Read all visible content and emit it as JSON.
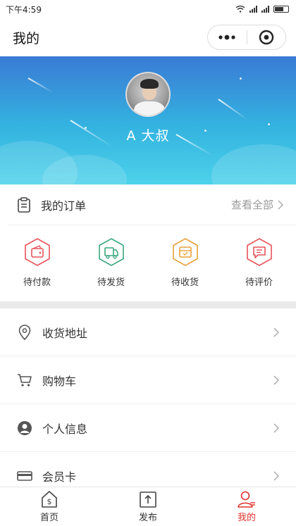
{
  "status": {
    "time": "下午4:59"
  },
  "nav": {
    "title": "我的"
  },
  "profile": {
    "name": "A 大叔"
  },
  "orders": {
    "title": "我的订单",
    "view_all": "查看全部",
    "items": [
      {
        "label": "待付款",
        "color": "#e8525a",
        "icon": "wallet-icon"
      },
      {
        "label": "待发货",
        "color": "#3aa77d",
        "icon": "truck-icon"
      },
      {
        "label": "待收货",
        "color": "#e8a13a",
        "icon": "package-icon"
      },
      {
        "label": "待评价",
        "color": "#e8525a",
        "icon": "comment-icon"
      }
    ]
  },
  "menu": {
    "items": [
      {
        "label": "收货地址",
        "icon": "location-pin-icon"
      },
      {
        "label": "购物车",
        "icon": "cart-icon"
      },
      {
        "label": "个人信息",
        "icon": "person-icon"
      },
      {
        "label": "会员卡",
        "icon": "card-icon"
      }
    ]
  },
  "tabbar": {
    "items": [
      {
        "label": "首页",
        "icon": "home-icon"
      },
      {
        "label": "发布",
        "icon": "upload-icon"
      },
      {
        "label": "我的",
        "icon": "profile-icon"
      }
    ],
    "active_color": "#e0332f"
  }
}
